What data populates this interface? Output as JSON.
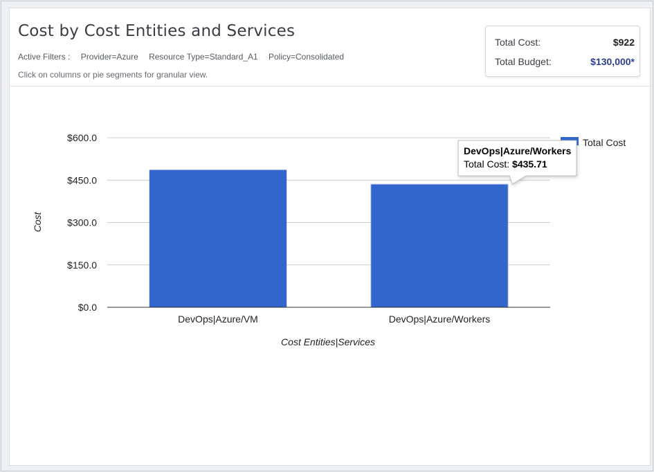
{
  "header": {
    "title": "Cost by Cost Entities and Services",
    "filters_label": "Active Filters :",
    "filters": [
      "Provider=Azure",
      "Resource Type=Standard_A1",
      "Policy=Consolidated"
    ],
    "hint": "Click on columns or pie segments for granular view."
  },
  "summary": {
    "total_cost_label": "Total Cost:",
    "total_cost_value": "$922",
    "total_budget_label": "Total Budget:",
    "total_budget_value": "$130,000*"
  },
  "chart_data": {
    "type": "bar",
    "categories": [
      "DevOps|Azure/VM",
      "DevOps|Azure/Workers"
    ],
    "series": [
      {
        "name": "Total Cost",
        "values": [
          486.29,
          435.71
        ],
        "color": "#3366cc"
      }
    ],
    "xlabel": "Cost Entities|Services",
    "ylabel": "Cost",
    "ylim": [
      0,
      600
    ],
    "yticks": [
      0,
      150,
      300,
      450,
      600
    ],
    "ytick_labels": [
      "$0.0",
      "$150.0",
      "$300.0",
      "$450.0",
      "$600.0"
    ],
    "grid": true,
    "legend": "top-right",
    "tooltip": {
      "category": "DevOps|Azure/Workers",
      "title": "DevOps|Azure/Workers",
      "label": "Total Cost:",
      "value": "$435.71"
    }
  }
}
